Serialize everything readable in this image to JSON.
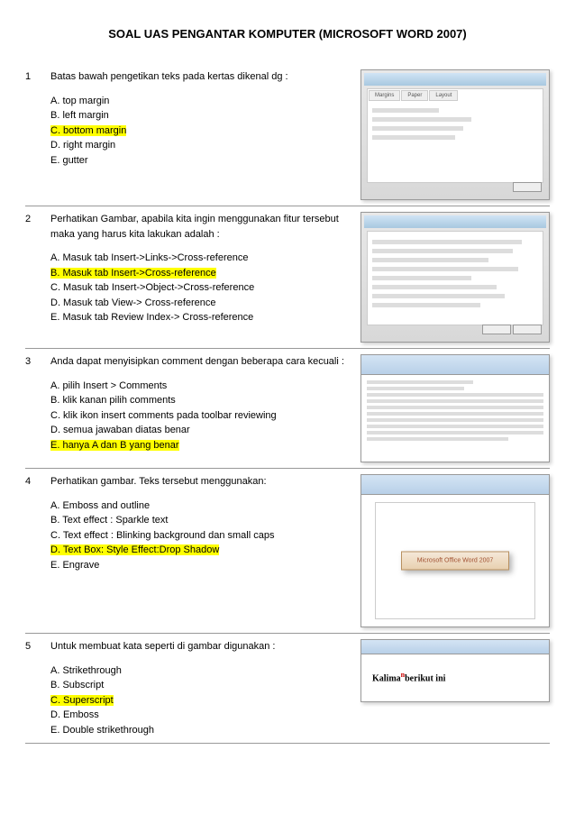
{
  "title": "SOAL UAS PENGANTAR KOMPUTER (MICROSOFT WORD 2007)",
  "questions": [
    {
      "num": "1",
      "text": "Batas bawah pengetikan teks pada kertas dikenal dg :",
      "options": [
        {
          "label": "A. top margin",
          "highlighted": false
        },
        {
          "label": "B. left margin",
          "highlighted": false
        },
        {
          "label": "C. bottom margin",
          "highlighted": true
        },
        {
          "label": "D. right margin",
          "highlighted": false
        },
        {
          "label": "E. gutter",
          "highlighted": false
        }
      ],
      "imageType": "page-setup-dialog"
    },
    {
      "num": "2",
      "text": "Perhatikan Gambar, apabila kita ingin menggunakan fitur tersebut maka yang harus kita lakukan adalah :",
      "options": [
        {
          "label": "A. Masuk tab Insert->Links->Cross-reference",
          "highlighted": false
        },
        {
          "label": "B. Masuk tab Insert->Cross-reference",
          "highlighted": true
        },
        {
          "label": "C. Masuk tab Insert->Object->Cross-reference",
          "highlighted": false
        },
        {
          "label": "D. Masuk tab View-> Cross-reference",
          "highlighted": false
        },
        {
          "label": "E. Masuk tab Review Index-> Cross-reference",
          "highlighted": false
        }
      ],
      "imageType": "cross-reference-dialog"
    },
    {
      "num": "3",
      "text": "Anda dapat menyisipkan comment dengan beberapa cara kecuali :",
      "options": [
        {
          "label": "A. pilih Insert > Comments",
          "highlighted": false
        },
        {
          "label": "B. klik kanan pilih comments",
          "highlighted": false
        },
        {
          "label": "C. klik ikon insert comments pada toolbar reviewing",
          "highlighted": false
        },
        {
          "label": "D. semua jawaban diatas benar",
          "highlighted": false
        },
        {
          "label": "E. hanya A dan B yang benar",
          "highlighted": true
        }
      ],
      "imageType": "comments-view"
    },
    {
      "num": "4",
      "text": "Perhatikan gambar. Teks tersebut menggunakan:",
      "options": [
        {
          "label": "A. Emboss and outline",
          "highlighted": false
        },
        {
          "label": "B. Text effect : Sparkle text",
          "highlighted": false
        },
        {
          "label": "C. Text effect : Blinking background dan small caps",
          "highlighted": false
        },
        {
          "label": "D. Text Box: Style Effect:Drop Shadow",
          "highlighted": true
        },
        {
          "label": "E. Engrave",
          "highlighted": false
        }
      ],
      "imageType": "textbox-shadow",
      "imageText": "Microsoft Office Word 2007"
    },
    {
      "num": "5",
      "text": "Untuk membuat kata seperti di gambar digunakan :",
      "options": [
        {
          "label": "A. Strikethrough",
          "highlighted": false
        },
        {
          "label": "B. Subscript",
          "highlighted": false
        },
        {
          "label": "C. Superscript",
          "highlighted": true
        },
        {
          "label": "D. Emboss",
          "highlighted": false
        },
        {
          "label": "E. Double strikethrough",
          "highlighted": false
        }
      ],
      "imageType": "superscript-example",
      "imageTextPre": "Kalima",
      "imageTextSuper": "n",
      "imageTextPost": "berikut ini"
    }
  ]
}
